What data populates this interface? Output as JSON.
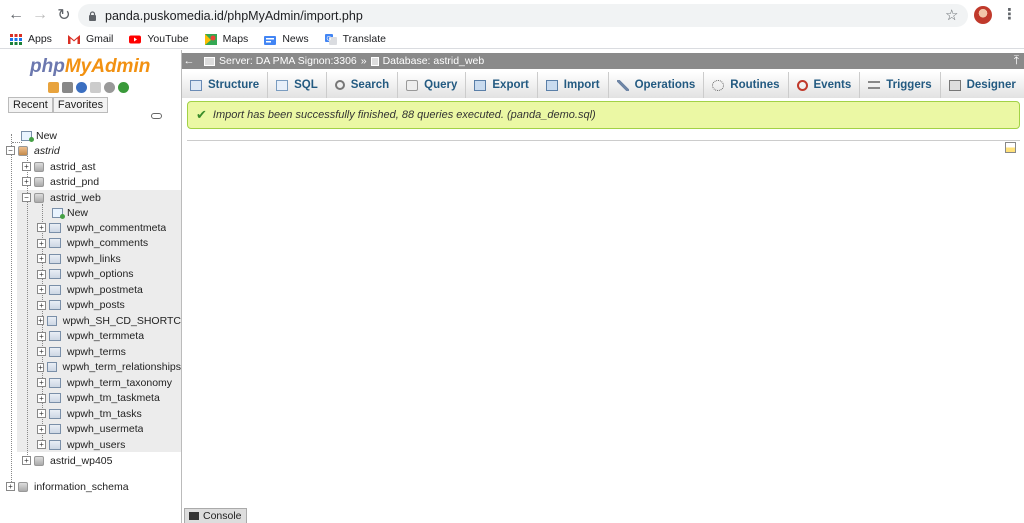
{
  "browser": {
    "url": "panda.puskomedia.id/phpMyAdmin/import.php",
    "bookmarks": [
      "Apps",
      "Gmail",
      "YouTube",
      "Maps",
      "News",
      "Translate"
    ]
  },
  "sidebar": {
    "logo_php": "php",
    "logo_my": "MyAdmin",
    "tab_recent": "Recent",
    "tab_favorites": "Favorites",
    "new_label": "New",
    "databases": {
      "astrid": "astrid",
      "astrid_ast": "astrid_ast",
      "astrid_pnd": "astrid_pnd",
      "astrid_web": "astrid_web",
      "astrid_wp405": "astrid_wp405",
      "information_schema": "information_schema"
    },
    "astrid_web_new": "New",
    "tables": [
      "wpwh_commentmeta",
      "wpwh_comments",
      "wpwh_links",
      "wpwh_options",
      "wpwh_postmeta",
      "wpwh_posts",
      "wpwh_SH_CD_SHORTC",
      "wpwh_termmeta",
      "wpwh_terms",
      "wpwh_term_relationships",
      "wpwh_term_taxonomy",
      "wpwh_tm_taskmeta",
      "wpwh_tm_tasks",
      "wpwh_usermeta",
      "wpwh_users"
    ]
  },
  "breadcrumb": {
    "server": "Server: DA PMA Signon:3306",
    "separator": "»",
    "database": "Database: astrid_web"
  },
  "tabs": [
    "Structure",
    "SQL",
    "Search",
    "Query",
    "Export",
    "Import",
    "Operations",
    "Routines",
    "Events",
    "Triggers",
    "Designer"
  ],
  "message": "Import has been successfully finished, 88 queries executed. (panda_demo.sql)",
  "console_label": "Console"
}
